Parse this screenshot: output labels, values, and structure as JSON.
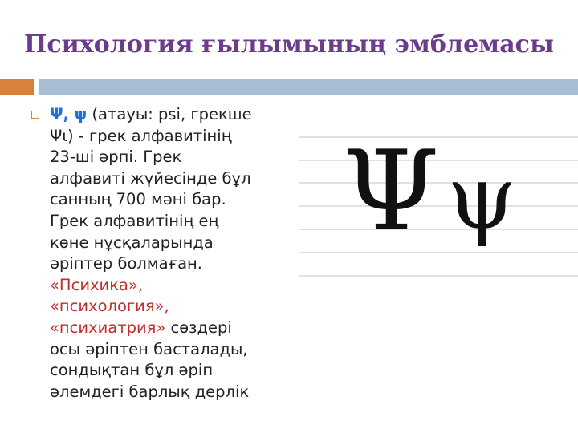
{
  "slide": {
    "title": "Психология ғылымының эмблемасы",
    "bullet": {
      "symbol": "Ψ, ψ",
      "line1_rest": " (атауы: psi, грекше",
      "line2": "Ψι) - грек алфавитінің",
      "line3": "23-ші әрпі. Грек",
      "line4": "алфавиті жүйесінде бұл",
      "line5": "санның 700 мәні бар.",
      "line6": "Грек алфавитінің ең",
      "line7": "көне нұсқаларында",
      "line8": "әріптер болмаған.",
      "line9": "«Психика»,",
      "line10": "«психология»,",
      "line11_red": "«психиатрия»",
      "line11_rest": " сөздері",
      "line12": "осы әріптен басталады,",
      "line13": "сондықтан бұл әріп",
      "line14": "әлемдегі барлық дерлік"
    },
    "figure": {
      "upper": "Ψ",
      "lower": "ψ"
    }
  },
  "colors": {
    "title": "#6b3b8e",
    "accent_orange": "#d9803a",
    "accent_blue": "#a9bdd4",
    "symbol_blue": "#1f6fd6",
    "highlight_red": "#c0302a"
  }
}
